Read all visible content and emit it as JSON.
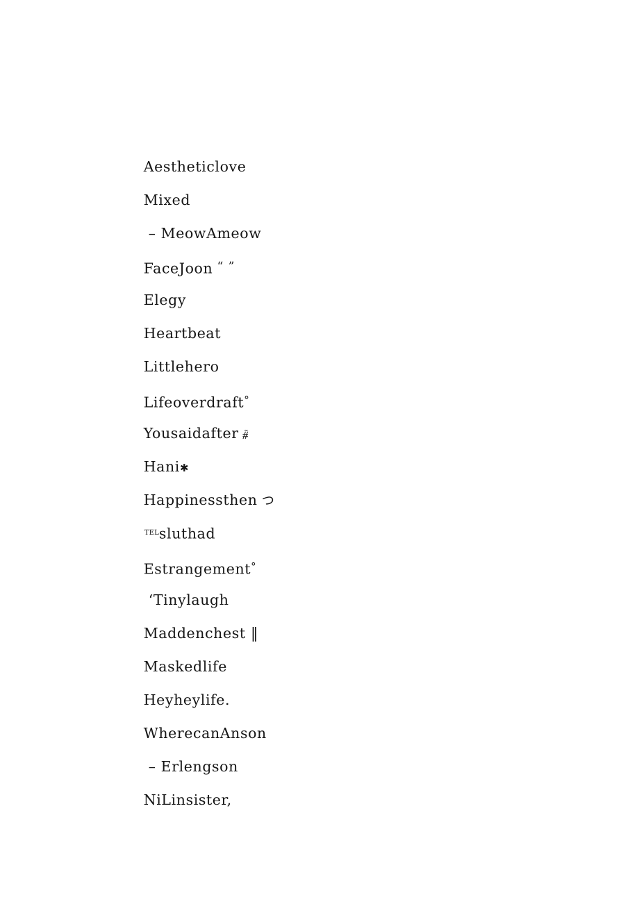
{
  "document": {
    "background_color": "#ffffff",
    "text_color": "#161616",
    "lines": [
      {
        "id": "line-1",
        "text": "Aestheticlove",
        "suffix": "",
        "indent": false
      },
      {
        "id": "line-2",
        "text": "Mixed",
        "suffix": "",
        "indent": false
      },
      {
        "id": "line-3",
        "text": "– MeowAmeow",
        "suffix": "",
        "indent": true
      },
      {
        "id": "line-4",
        "text": "FaceJoon",
        "suffix": " “ ”",
        "indent": false
      },
      {
        "id": "line-5",
        "text": "Elegy",
        "suffix": "",
        "indent": false
      },
      {
        "id": "line-6",
        "text": "Heartbeat",
        "suffix": "",
        "indent": false
      },
      {
        "id": "line-7",
        "text": "Littlehero",
        "suffix": "",
        "indent": false
      },
      {
        "id": "line-8",
        "text": "Lifeoverdraft",
        "suffix": "°",
        "indent": false
      },
      {
        "id": "line-9",
        "text": "Yousaidafter",
        "suffix": " ⧤",
        "indent": false
      },
      {
        "id": "line-10",
        "text": "Hani",
        "suffix": "✱",
        "indent": false
      },
      {
        "id": "line-11",
        "text": "Happinessthen",
        "suffix": " つ",
        "indent": false
      },
      {
        "id": "line-12",
        "text": "sluthad",
        "prefix": "TEL",
        "suffix": "",
        "indent": false
      },
      {
        "id": "line-13",
        "text": "Estrangement",
        "suffix": "°",
        "indent": false
      },
      {
        "id": "line-14",
        "text": "‘Tinylaugh",
        "suffix": "",
        "indent": true
      },
      {
        "id": "line-15",
        "text": "Maddenchest",
        "suffix": " ‖",
        "indent": false
      },
      {
        "id": "line-16",
        "text": "Maskedlife",
        "suffix": "",
        "indent": false
      },
      {
        "id": "line-17",
        "text": "Heyheylife.",
        "suffix": "",
        "indent": false
      },
      {
        "id": "line-18",
        "text": "WherecanAnson",
        "suffix": "",
        "indent": false
      },
      {
        "id": "line-19",
        "text": "– Erlengson",
        "suffix": "",
        "indent": true
      },
      {
        "id": "line-20",
        "text": "NiLinsister,",
        "suffix": "",
        "indent": false
      }
    ]
  }
}
